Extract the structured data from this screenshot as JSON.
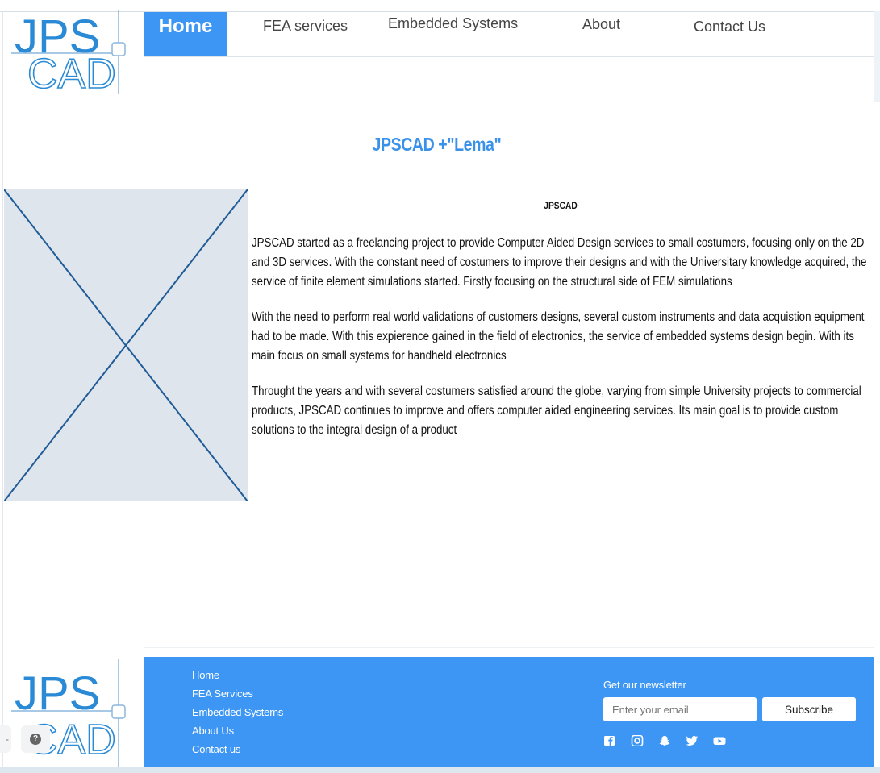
{
  "logo": {
    "line1": "JPS",
    "line2": "CAD"
  },
  "nav": {
    "items": [
      {
        "label": "Home",
        "active": true
      },
      {
        "label": "FEA services",
        "active": false
      },
      {
        "label": "Embedded Systems",
        "active": false
      },
      {
        "label": "About",
        "active": false
      },
      {
        "label": "Contact Us",
        "active": false
      }
    ]
  },
  "main": {
    "title": "JPSCAD +\"Lema\"",
    "article_heading": "JPSCAD",
    "paragraphs": [
      "JPSCAD started as a freelancing project to provide Computer Aided Design services to small costumers, focusing only on the 2D and 3D services. With the constant need of costumers to improve their designs and with the Universitary knowledge acquired, the service of finite element simulations started. Firstly focusing on the structural side of FEM simulations",
      "With the need to perform real world validations of customers designs, several custom instruments and data acquistion equipment had to be made. With this expierence gained in the field of electronics, the service of embedded systems design begin. With its main focus on small systems for handheld electronics",
      "Throught the years and with several costumers satisfied around the globe, varying from simple University projects to commercial products, JPSCAD continues to improve and offers computer aided engineering services. Its main goal is to provide custom solutions to the integral design of a product"
    ]
  },
  "footer": {
    "links": [
      "Home",
      "FEA Services",
      "Embedded Systems",
      "About Us",
      "Contact us"
    ],
    "newsletter_label": "Get our newsletter",
    "email_placeholder": "Enter your email",
    "subscribe_label": "Subscribe",
    "social_icons": [
      "facebook-icon",
      "instagram-icon",
      "snapchat-icon",
      "twitter-icon",
      "youtube-icon"
    ]
  },
  "help_widget": {
    "icon": "help-icon",
    "glyph": "?"
  },
  "colors": {
    "brand_blue": "#3d96f4",
    "title_blue": "#3a91ea",
    "logo_blue": "#2a8ad6",
    "placeholder_bg": "#dfe5ec",
    "placeholder_line": "#1f5b96"
  }
}
